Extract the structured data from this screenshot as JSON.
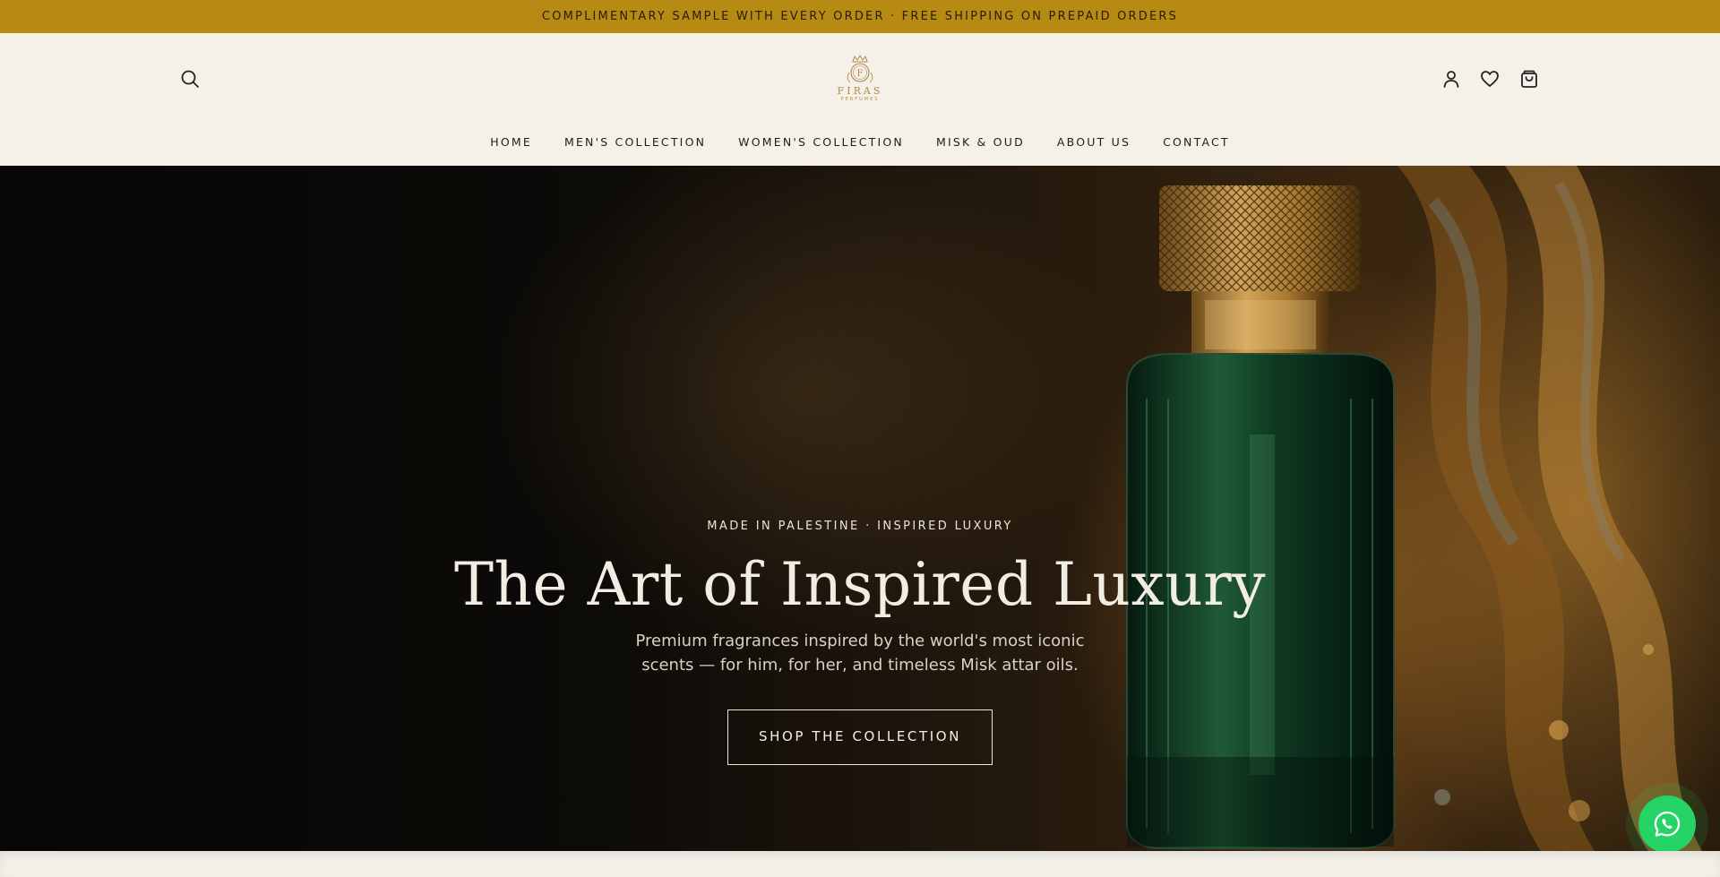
{
  "announcement": {
    "text": "COMPLIMENTARY SAMPLE WITH EVERY ORDER · FREE SHIPPING ON PREPAID ORDERS"
  },
  "header": {
    "logo": {
      "name": "FIRAS",
      "sub": "PERFUMES",
      "monogram": "F"
    },
    "icons": {
      "search": "search-icon",
      "account": "user-icon",
      "wishlist": "heart-icon",
      "cart": "shopping-bag-icon"
    }
  },
  "nav": {
    "items": [
      {
        "label": "HOME"
      },
      {
        "label": "MEN'S COLLECTION"
      },
      {
        "label": "WOMEN'S COLLECTION"
      },
      {
        "label": "MISK & OUD"
      },
      {
        "label": "ABOUT US"
      },
      {
        "label": "CONTACT"
      }
    ]
  },
  "hero": {
    "kicker": "MADE IN PALESTINE · INSPIRED LUXURY",
    "headline": "The Art of Inspired Luxury",
    "subtext": "Premium fragrances inspired by the world's most iconic scents — for him, for her, and timeless Misk attar oils.",
    "cta_label": "SHOP THE COLLECTION"
  },
  "floating": {
    "whatsapp_icon": "whatsapp-icon"
  },
  "colors": {
    "announcement_bg": "#b78a13",
    "header_bg": "#f5f1e8",
    "whatsapp": "#25d366",
    "gold": "#b08a4a"
  }
}
